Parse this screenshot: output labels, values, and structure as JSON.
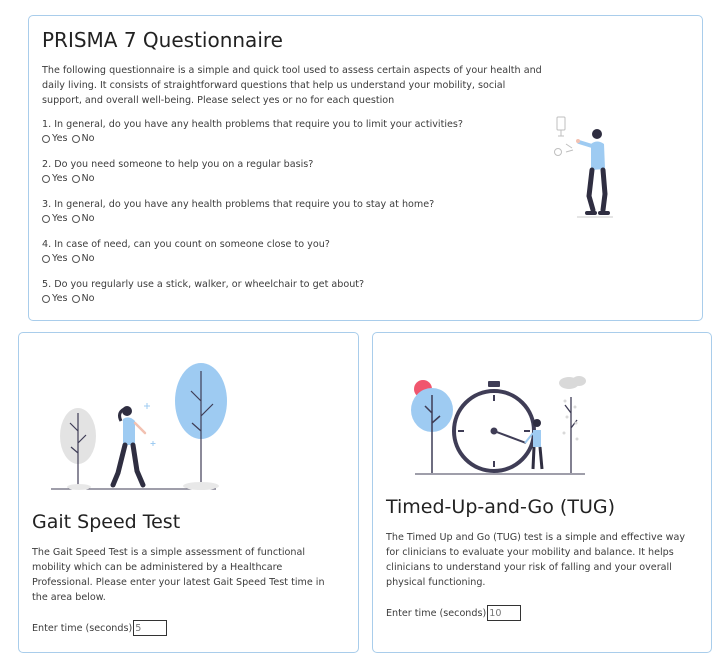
{
  "prisma": {
    "title": "PRISMA 7 Questionnaire",
    "description": "The following questionnaire is a simple and quick tool used to assess certain aspects of your health and daily living. It consists of straightforward questions that help us understand your mobility, social support, and overall well-being. Please select yes or no for each question",
    "questions": [
      {
        "text": "1. In general, do you have any health problems that require you to limit your activities?",
        "yes": "Yes",
        "no": "No"
      },
      {
        "text": "2. Do you need someone to help you on a regular basis?",
        "yes": "Yes",
        "no": "No"
      },
      {
        "text": "3. In general, do you have any health problems that require you to stay at home?",
        "yes": "Yes",
        "no": "No"
      },
      {
        "text": "4. In case of need, can you count on someone close to you?",
        "yes": "Yes",
        "no": "No"
      },
      {
        "text": "5. Do you regularly use a stick, walker, or wheelchair to get about?",
        "yes": "Yes",
        "no": "No"
      }
    ],
    "illustration": "person-pointing-at-screen-illustration"
  },
  "gait": {
    "title": "Gait Speed Test",
    "description": "The Gait Speed Test is a simple assessment of functional mobility which can be administered by a Healthcare Professional. Please enter your latest Gait Speed Test time in the area below.",
    "time_label": "Enter time (seconds)",
    "time_value": "5",
    "illustration": "woman-walking-between-trees-illustration"
  },
  "tug": {
    "title": "Timed-Up-and-Go (TUG)",
    "description": "The Timed Up and Go (TUG) test is a simple and effective way for clinicians to evaluate your mobility and balance. It helps clinicians to understand your risk of falling and your overall physical functioning.",
    "time_label": "Enter time (seconds)",
    "time_value": "10",
    "illustration": "person-beside-large-stopwatch-illustration"
  },
  "colors": {
    "card_border": "#a9cdeb",
    "accent_blue": "#9ecbf2",
    "dark": "#2f2e41",
    "red": "#f0566e"
  }
}
